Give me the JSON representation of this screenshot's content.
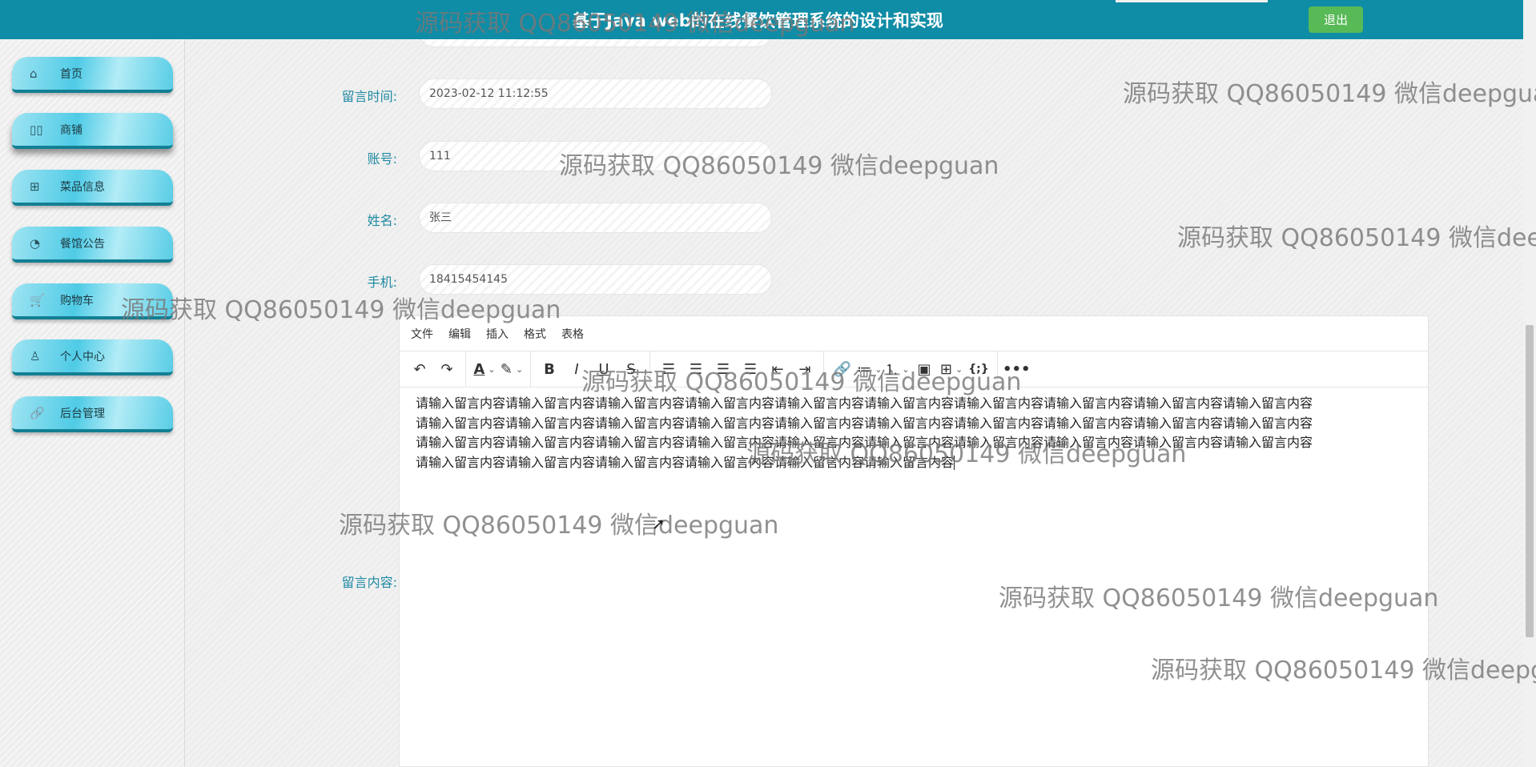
{
  "header": {
    "title": "基于Java web的在线餐饮管理系统的设计和实现",
    "logout_label": "退出"
  },
  "sidebar": {
    "items": [
      {
        "label": "首页",
        "icon": "home-icon",
        "glyph": "⌂"
      },
      {
        "label": "商铺",
        "icon": "shop-icon",
        "glyph": "▯▯"
      },
      {
        "label": "菜品信息",
        "icon": "dish-icon",
        "glyph": "⊞"
      },
      {
        "label": "餐馆公告",
        "icon": "notice-icon",
        "glyph": "◔"
      },
      {
        "label": "购物车",
        "icon": "cart-icon",
        "glyph": "🛒"
      },
      {
        "label": "个人中心",
        "icon": "user-icon",
        "glyph": "♙"
      },
      {
        "label": "后台管理",
        "icon": "link-icon",
        "glyph": "🔗"
      }
    ]
  },
  "form": {
    "time_label": "留言时间:",
    "time_value": "2023-02-12 11:12:55",
    "account_label": "账号:",
    "account_value": "111",
    "name_label": "姓名:",
    "name_value": "张三",
    "phone_label": "手机:",
    "phone_value": "18415454145",
    "content_label": "留言内容:"
  },
  "editor": {
    "menus": [
      "文件",
      "编辑",
      "插入",
      "格式",
      "表格"
    ],
    "lines": [
      "请输入留言内容请输入留言内容请输入留言内容请输入留言内容请输入留言内容请输入留言内容请输入留言内容请输入留言内容请输入留言内容请输入留言内容",
      "请输入留言内容请输入留言内容请输入留言内容请输入留言内容请输入留言内容请输入留言内容请输入留言内容请输入留言内容请输入留言内容请输入留言内容",
      "请输入留言内容请输入留言内容请输入留言内容请输入留言内容请输入留言内容请输入留言内容请输入留言内容请输入留言内容请输入留言内容请输入留言内容",
      "请输入留言内容请输入留言内容请输入留言内容请输入留言内容请输入留言内容请输入留言内容"
    ]
  },
  "watermark": "源码获取 QQ86050149 微信deepguan"
}
